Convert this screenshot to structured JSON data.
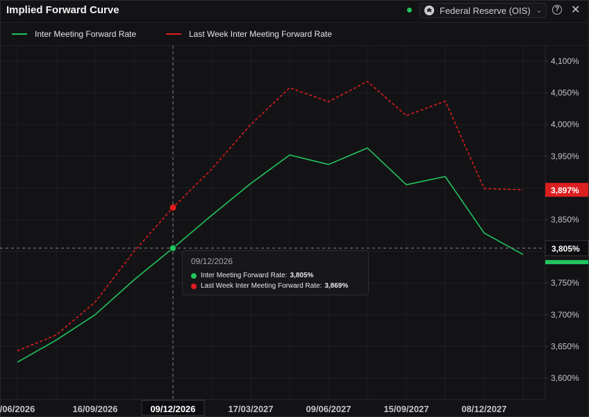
{
  "header": {
    "title": "Implied Forward Curve",
    "source_label": "Federal Reserve (OIS)",
    "icons": [
      "federal-reserve-seal-icon",
      "chevron-down-icon",
      "help-icon",
      "close-icon"
    ],
    "status_color": "#22c55e"
  },
  "chart_data": {
    "type": "line",
    "title": "",
    "x_tick_labels": [
      "/06/2026",
      "16/09/2026",
      "09/12/2026",
      "17/03/2027",
      "09/06/2027",
      "15/09/2027",
      "08/12/2027"
    ],
    "x_tick_index": [
      0,
      2,
      4,
      6,
      8,
      10,
      12
    ],
    "x_index_range": [
      0,
      13.5
    ],
    "y_tick_labels": [
      "4,100%",
      "4,050%",
      "4,000%",
      "3,950%",
      "3,900%",
      "3,850%",
      "3,800%",
      "3,750%",
      "3,700%",
      "3,650%",
      "3,600%"
    ],
    "y_ticks": [
      4.1,
      4.05,
      4.0,
      3.95,
      3.9,
      3.85,
      3.8,
      3.75,
      3.7,
      3.65,
      3.6
    ],
    "ylim": [
      3.57,
      4.12
    ],
    "grid": true,
    "legend_position": "top-left",
    "series": [
      {
        "name": "Inter Meeting Forward Rate",
        "color": "#22c55e",
        "style": "solid",
        "x_index": [
          0,
          1,
          2,
          3,
          4,
          5,
          6,
          7,
          8,
          9,
          10,
          11,
          12,
          13
        ],
        "values": [
          3.625,
          3.66,
          3.7,
          3.755,
          3.805,
          3.857,
          3.907,
          3.952,
          3.937,
          3.963,
          3.905,
          3.918,
          3.829,
          3.795
        ],
        "last_value_label": "3,805%"
      },
      {
        "name": "Last Week Inter Meeting Forward Rate",
        "color": "#e11d1d",
        "style": "dashed",
        "x_index": [
          0,
          1,
          2,
          3,
          4,
          5,
          6,
          7,
          8,
          9,
          10,
          11,
          12,
          13
        ],
        "values": [
          3.643,
          3.668,
          3.72,
          3.8,
          3.869,
          3.93,
          4.0,
          4.058,
          4.036,
          4.068,
          4.014,
          4.037,
          3.899,
          3.897
        ],
        "last_value_label": "3,897%"
      }
    ],
    "crosshair": {
      "x_label": "09/12/2026",
      "x_index": 4,
      "y_label": "3,805%",
      "y_value": 3.805
    }
  },
  "tooltip": {
    "date": "09/12/2026",
    "rows": [
      {
        "label": "Inter Meeting Forward Rate:",
        "value": "3,805%",
        "color": "#22c55e"
      },
      {
        "label": "Last Week Inter Meeting Forward Rate:",
        "value": "3,869%",
        "color": "#e11d1d"
      }
    ]
  }
}
